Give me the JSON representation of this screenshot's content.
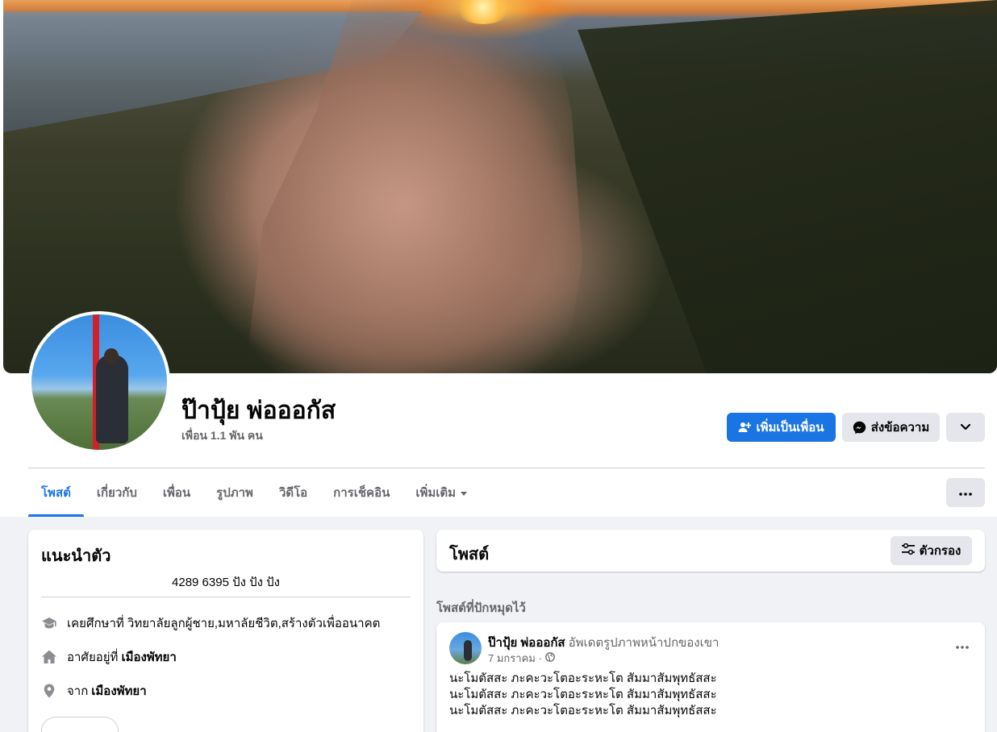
{
  "profile": {
    "name": "ป๊าปุ้ย พ่อออกัส",
    "friends": "เพื่อน 1.1 พัน คน"
  },
  "actions": {
    "add_friend": "เพิ่มเป็นเพื่อน",
    "message": "ส่งข้อความ"
  },
  "tabs": [
    {
      "label": "โพสต์"
    },
    {
      "label": "เกี่ยวกับ"
    },
    {
      "label": "เพื่อน"
    },
    {
      "label": "รูปภาพ"
    },
    {
      "label": "วิดีโอ"
    },
    {
      "label": "การเช็คอิน"
    },
    {
      "label": "เพิ่มเติม"
    }
  ],
  "intro": {
    "title": "แนะนำตัว",
    "bio": "4289 6395 ปัง ปัง ปัง",
    "education": "เคยศึกษาที่ วิทยาลัยลูกผู้ชาย,มหาลัยชีวิต,สร้างตัวเพื่ออนาคต",
    "lives_prefix": "อาศัยอยู่ที่",
    "lives_place": "เมืองพัทยา",
    "from_prefix": "จาก",
    "from_place": "เมืองพัทยา"
  },
  "posts": {
    "title": "โพสต์",
    "filter": "ตัวกรอง",
    "pinned_label": "โพสต์ที่ปักหมุดไว้",
    "pinned": {
      "author": "ป๊าปุ้ย พ่อออกัส",
      "action": "อัพเดตรูปภาพหน้าปกของเขา",
      "date": "7 มกราคม ·",
      "lines": [
        "นะโมตัสสะ ภะคะวะโตอะระหะโต สัมมาสัมพุทธัสสะ",
        "นะโมตัสสะ ภะคะวะโตอะระหะโต สัมมาสัมพุทธัสสะ",
        "นะโมตัสสะ ภะคะวะโตอะระหะโต สัมมาสัมพุทธัสสะ"
      ]
    }
  },
  "icons": {
    "add_friend": "person-plus-icon",
    "message": "messenger-icon",
    "more": "chevron-down-icon",
    "education": "graduation-cap-icon",
    "home": "home-icon",
    "location": "map-pin-icon",
    "filter": "sliders-icon",
    "privacy": "globe-icon"
  },
  "colors": {
    "accent": "#1b74e4",
    "secondary_bg": "#e4e6eb",
    "page_bg": "#f0f2f5"
  }
}
